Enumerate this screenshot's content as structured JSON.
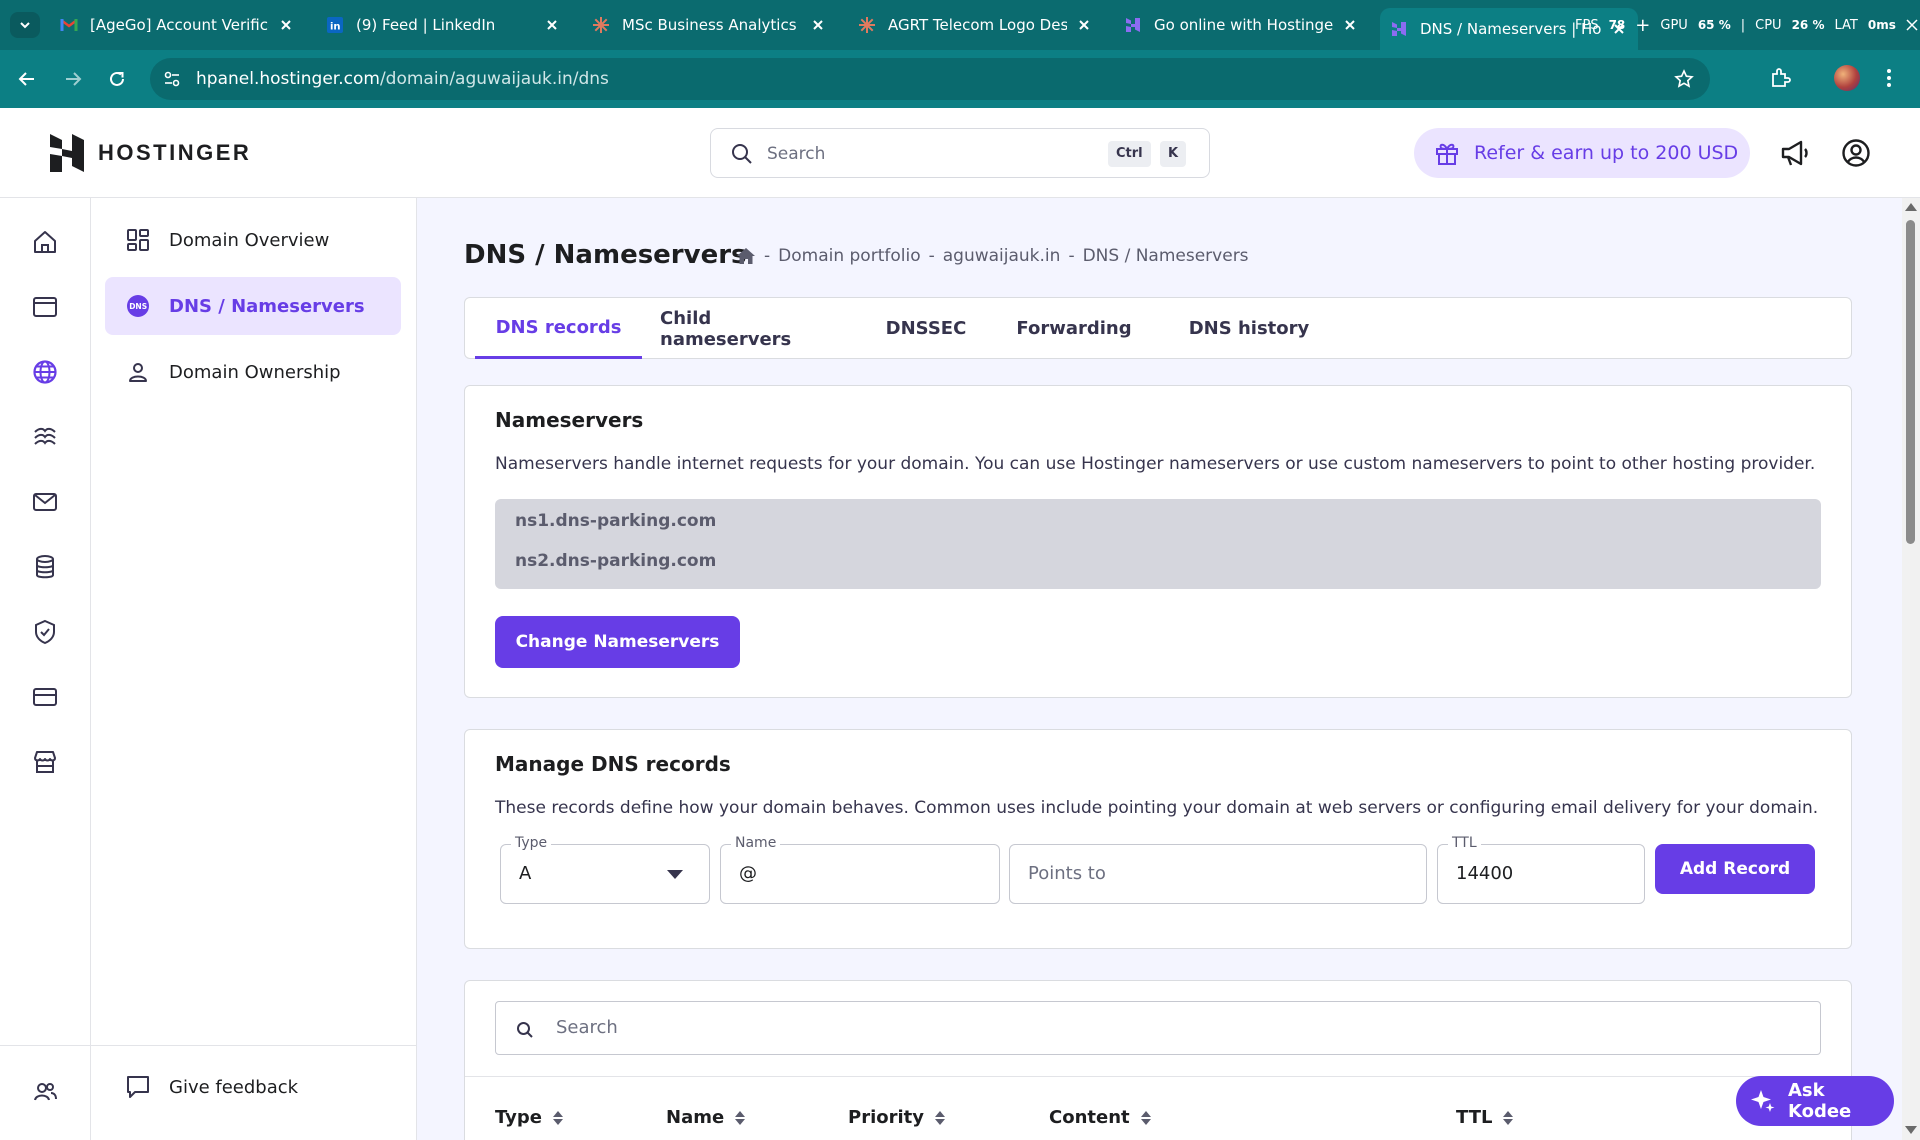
{
  "browser": {
    "tabs": [
      {
        "title": "[AgeGo] Account Verificati",
        "icon": "gmail-icon"
      },
      {
        "title": "(9) Feed | LinkedIn",
        "icon": "linkedin-icon"
      },
      {
        "title": "MSc Business Analytics Pro",
        "icon": "claude-icon"
      },
      {
        "title": "AGRT Telecom Logo Desig",
        "icon": "claude-icon"
      },
      {
        "title": "Go online with Hostinger U",
        "icon": "hostinger-icon"
      },
      {
        "title": "DNS / Nameservers | Hos",
        "icon": "hostinger-icon",
        "active": true
      }
    ],
    "perf": {
      "fps_label": "FPS",
      "fps": "78",
      "gpu_label": "GPU",
      "gpu": "65",
      "gpu_unit": "%",
      "cpu_label": "CPU",
      "cpu": "26",
      "cpu_unit": "%",
      "lat_label": "LAT",
      "lat": "0",
      "lat_unit": "ms"
    },
    "url": {
      "host": "hpanel.hostinger.com",
      "path": "/domain/aguwaijauk.in/dns"
    }
  },
  "header": {
    "logo": "HOSTINGER",
    "search_placeholder": "Search",
    "kbd_ctrl": "Ctrl",
    "kbd_k": "K",
    "refer": "Refer & earn up to 200 USD"
  },
  "subnav": {
    "items": [
      {
        "label": "Domain Overview",
        "icon": "grid-icon"
      },
      {
        "label": "DNS / Nameservers",
        "icon": "dns-icon",
        "active": true
      },
      {
        "label": "Domain Ownership",
        "icon": "person-icon"
      }
    ],
    "feedback": "Give feedback"
  },
  "page": {
    "title": "DNS / Nameservers",
    "breadcrumb": [
      "Domain portfolio",
      "aguwaijauk.in",
      "DNS / Nameservers"
    ],
    "breadcrumb_sep": "-",
    "tabs": [
      "DNS records",
      "Child nameservers",
      "DNSSEC",
      "Forwarding",
      "DNS history"
    ],
    "active_tab": "DNS records"
  },
  "nameservers": {
    "title": "Nameservers",
    "description": "Nameservers handle internet requests for your domain. You can use Hostinger nameservers or use custom nameservers to point to other hosting provider.",
    "list": [
      "ns1.dns-parking.com",
      "ns2.dns-parking.com"
    ],
    "button": "Change Nameservers"
  },
  "manage": {
    "title": "Manage DNS records",
    "description": "These records define how your domain behaves. Common uses include pointing your domain at web servers or configuring email delivery for your domain.",
    "type_label": "Type",
    "type_value": "A",
    "name_label": "Name",
    "name_value": "@",
    "points_placeholder": "Points to",
    "ttl_label": "TTL",
    "ttl_value": "14400",
    "button": "Add Record"
  },
  "records": {
    "search_placeholder": "Search",
    "columns": [
      "Type",
      "Name",
      "Priority",
      "Content",
      "TTL"
    ]
  },
  "kodee": "Ask Kodee",
  "colors": {
    "brand": "#673de6",
    "browser": "#0c7f84",
    "brand_light": "#ebe4ff"
  }
}
